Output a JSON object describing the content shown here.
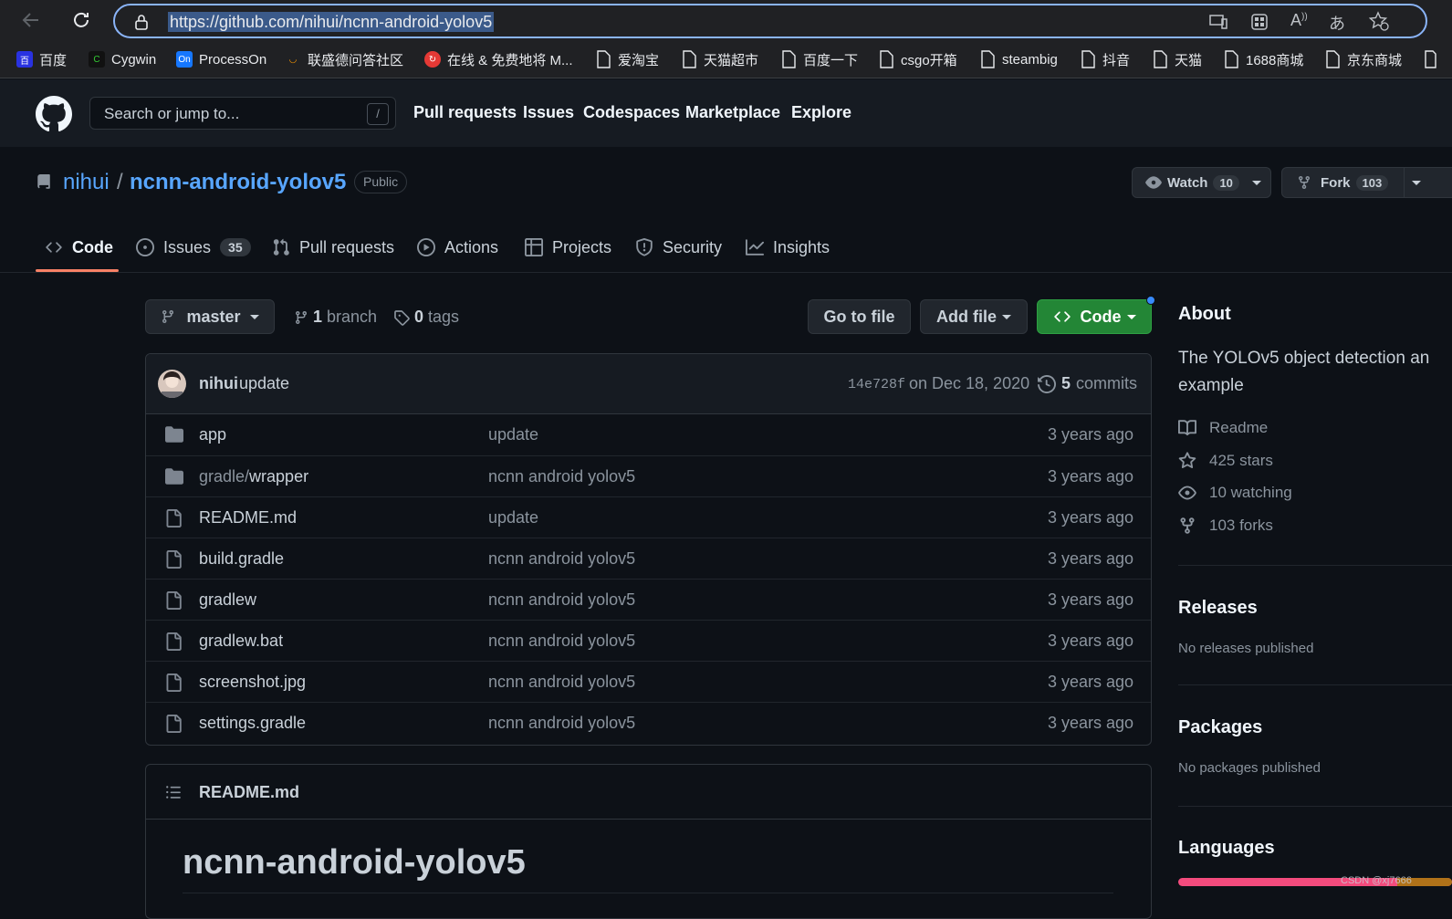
{
  "browser": {
    "url": "https://github.com/nihui/ncnn-android-yolov5",
    "bookmarks": [
      {
        "label": "百度",
        "icon": "baidu-icon"
      },
      {
        "label": "Cygwin",
        "icon": "cygwin-icon"
      },
      {
        "label": "ProcessOn",
        "icon": "processon-icon"
      },
      {
        "label": "联盛德问答社区",
        "icon": "site-icon"
      },
      {
        "label": "在线 & 免费地将 M...",
        "icon": "convert-icon"
      },
      {
        "label": "爱淘宝",
        "icon": "page-icon"
      },
      {
        "label": "天猫超市",
        "icon": "page-icon"
      },
      {
        "label": "百度一下",
        "icon": "page-icon"
      },
      {
        "label": "csgo开箱",
        "icon": "page-icon"
      },
      {
        "label": "steambig",
        "icon": "page-icon"
      },
      {
        "label": "抖音",
        "icon": "page-icon"
      },
      {
        "label": "天猫",
        "icon": "page-icon"
      },
      {
        "label": "1688商城",
        "icon": "page-icon"
      },
      {
        "label": "京东商城",
        "icon": "page-icon"
      }
    ]
  },
  "header": {
    "search_placeholder": "Search or jump to...",
    "search_shortcut": "/",
    "nav": [
      "Pull requests",
      "Issues",
      "Codespaces",
      "Marketplace",
      "Explore"
    ]
  },
  "repo": {
    "owner": "nihui",
    "separator": "/",
    "name": "ncnn-android-yolov5",
    "visibility": "Public",
    "watch_label": "Watch",
    "watch_count": "10",
    "fork_label": "Fork",
    "fork_count": "103"
  },
  "tabs": [
    {
      "label": "Code",
      "count": null,
      "active": true
    },
    {
      "label": "Issues",
      "count": "35"
    },
    {
      "label": "Pull requests",
      "count": null
    },
    {
      "label": "Actions",
      "count": null
    },
    {
      "label": "Projects",
      "count": null
    },
    {
      "label": "Security",
      "count": null
    },
    {
      "label": "Insights",
      "count": null
    }
  ],
  "toolbar": {
    "branch": "master",
    "branch_count": "1",
    "branch_word": "branch",
    "tag_count": "0",
    "tag_word": "tags",
    "goto_file": "Go to file",
    "add_file": "Add file",
    "code": "Code"
  },
  "commit": {
    "author": "nihui",
    "message": "update",
    "hash": "14e728f",
    "date": "on Dec 18, 2020",
    "commit_count": "5",
    "commit_word": "commits"
  },
  "files": [
    {
      "type": "dir",
      "prefix": "",
      "name": "app",
      "message": "update",
      "age": "3 years ago"
    },
    {
      "type": "dir",
      "prefix": "gradle/",
      "name": "wrapper",
      "message": "ncnn android yolov5",
      "age": "3 years ago"
    },
    {
      "type": "file",
      "prefix": "",
      "name": "README.md",
      "message": "update",
      "age": "3 years ago"
    },
    {
      "type": "file",
      "prefix": "",
      "name": "build.gradle",
      "message": "ncnn android yolov5",
      "age": "3 years ago"
    },
    {
      "type": "file",
      "prefix": "",
      "name": "gradlew",
      "message": "ncnn android yolov5",
      "age": "3 years ago"
    },
    {
      "type": "file",
      "prefix": "",
      "name": "gradlew.bat",
      "message": "ncnn android yolov5",
      "age": "3 years ago"
    },
    {
      "type": "file",
      "prefix": "",
      "name": "screenshot.jpg",
      "message": "ncnn android yolov5",
      "age": "3 years ago"
    },
    {
      "type": "file",
      "prefix": "",
      "name": "settings.gradle",
      "message": "ncnn android yolov5",
      "age": "3 years ago"
    }
  ],
  "readme": {
    "file_label": "README.md",
    "heading": "ncnn-android-yolov5"
  },
  "sidebar": {
    "about_title": "About",
    "description": "The YOLOv5 object detection an",
    "description_line2": "example",
    "readme": "Readme",
    "stars": "425 stars",
    "watching": "10 watching",
    "forks": "103 forks",
    "releases_title": "Releases",
    "releases_note": "No releases published",
    "packages_title": "Packages",
    "packages_note": "No packages published",
    "languages_title": "Languages"
  },
  "watermark": "CSDN @xj7666",
  "colors": {
    "accent": "#58a6ff",
    "code_button": "#238636",
    "tab_underline": "#f78166",
    "language_bar": "#f34b7d"
  }
}
